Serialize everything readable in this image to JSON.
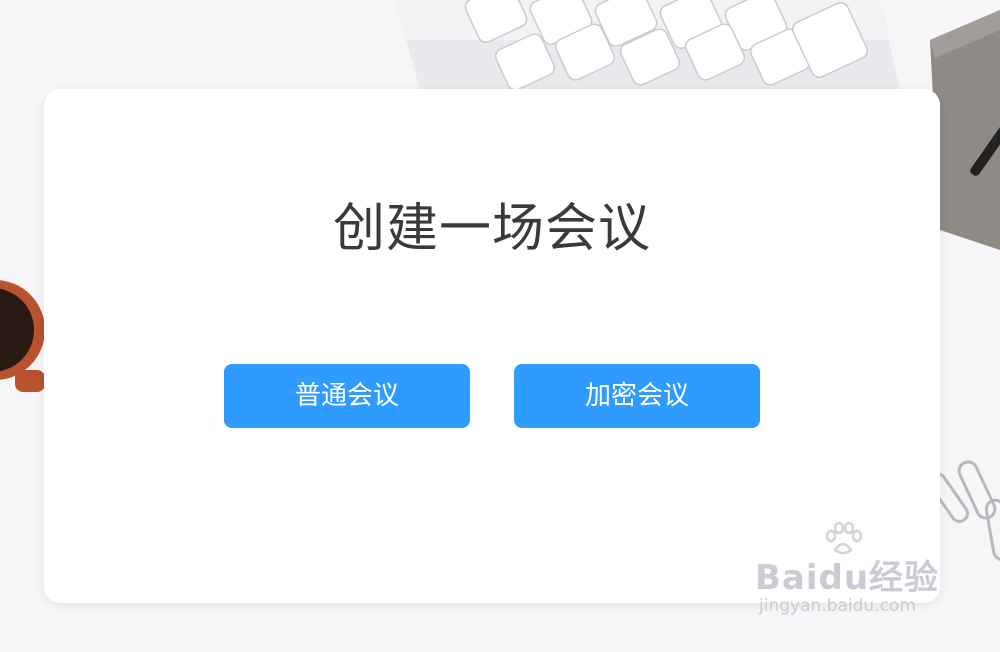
{
  "dialog": {
    "title": "创建一场会议",
    "buttons": {
      "normal_meeting": "普通会议",
      "encrypted_meeting": "加密会议"
    }
  },
  "watermark": {
    "brand_text": "Baidu经验",
    "url": "jingyan.baidu.com"
  },
  "colors": {
    "button_blue": "#2f9bff",
    "title_text": "#3a3a3a",
    "card_bg": "#ffffff",
    "page_bg": "#f6f6f8"
  },
  "icons": {
    "keyboard": "keyboard-image",
    "coffee_cup": "coffee-cup-image",
    "notebook": "notebook-image",
    "paper_clips": "paper-clips-image",
    "watermark_paw": "baidu-paw-icon"
  }
}
